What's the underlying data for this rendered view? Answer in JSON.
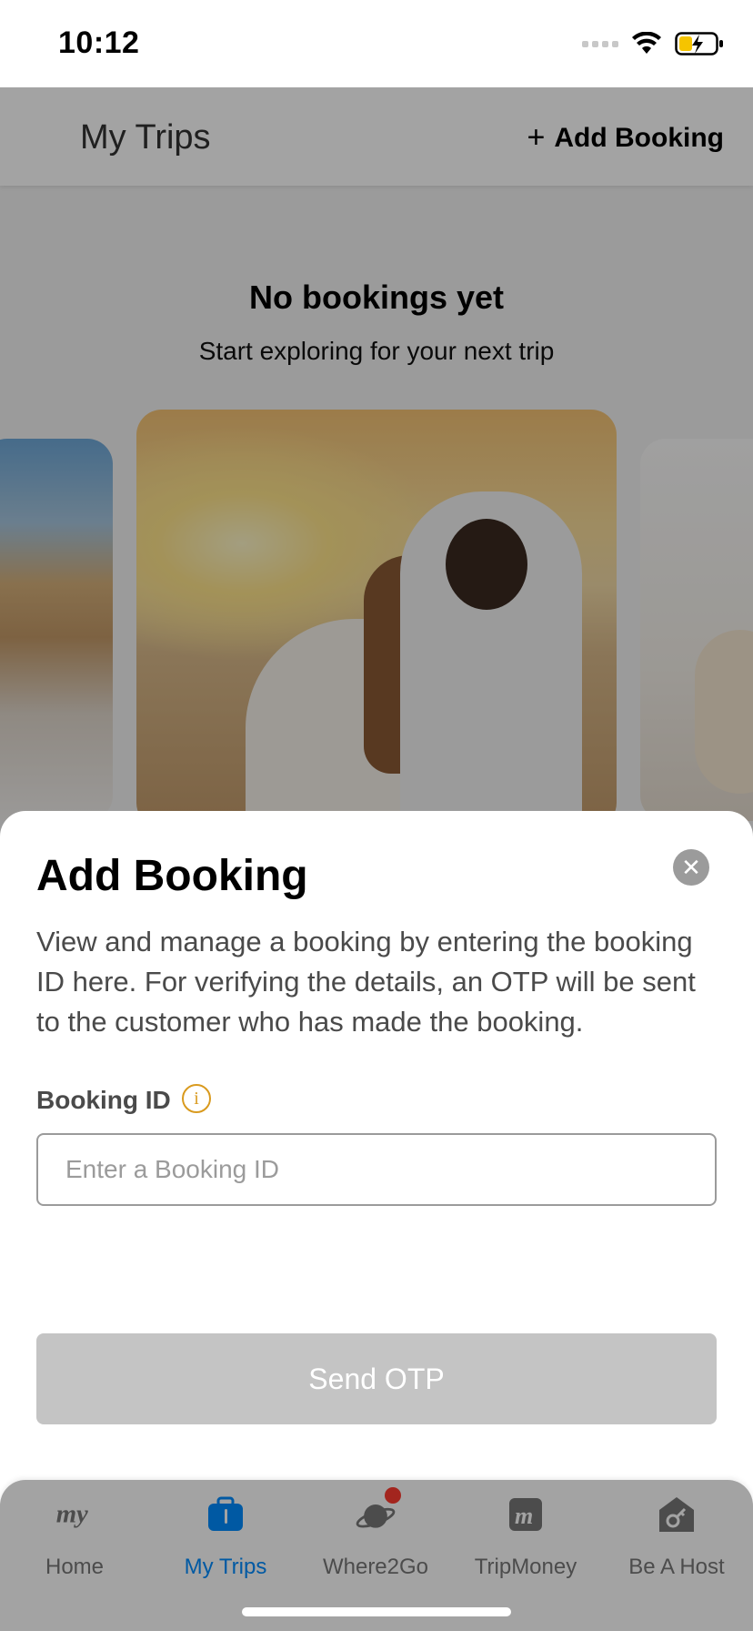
{
  "status_bar": {
    "time": "10:12"
  },
  "header": {
    "title": "My Trips",
    "add_booking_label": "Add Booking"
  },
  "empty_state": {
    "title": "No bookings yet",
    "subtitle": "Start exploring for your next trip"
  },
  "sheet": {
    "title": "Add Booking",
    "description": "View and manage a booking by entering the booking ID here. For verifying the details, an OTP will be sent to the customer who has made the booking.",
    "field_label": "Booking ID",
    "input_placeholder": "Enter a Booking ID",
    "input_value": "",
    "send_otp_label": "Send OTP"
  },
  "bottom_nav": {
    "items": [
      {
        "label": "Home",
        "icon": "my-logo-icon",
        "active": false
      },
      {
        "label": "My Trips",
        "icon": "suitcase-icon",
        "active": true
      },
      {
        "label": "Where2Go",
        "icon": "planet-icon",
        "active": false,
        "badge": true
      },
      {
        "label": "TripMoney",
        "icon": "m-logo-icon",
        "active": false
      },
      {
        "label": "Be A Host",
        "icon": "key-house-icon",
        "active": false
      }
    ]
  },
  "colors": {
    "accent": "#008cff",
    "info": "#d99a1e",
    "badge": "#ff3b30",
    "disabled_button": "#c4c4c4"
  }
}
